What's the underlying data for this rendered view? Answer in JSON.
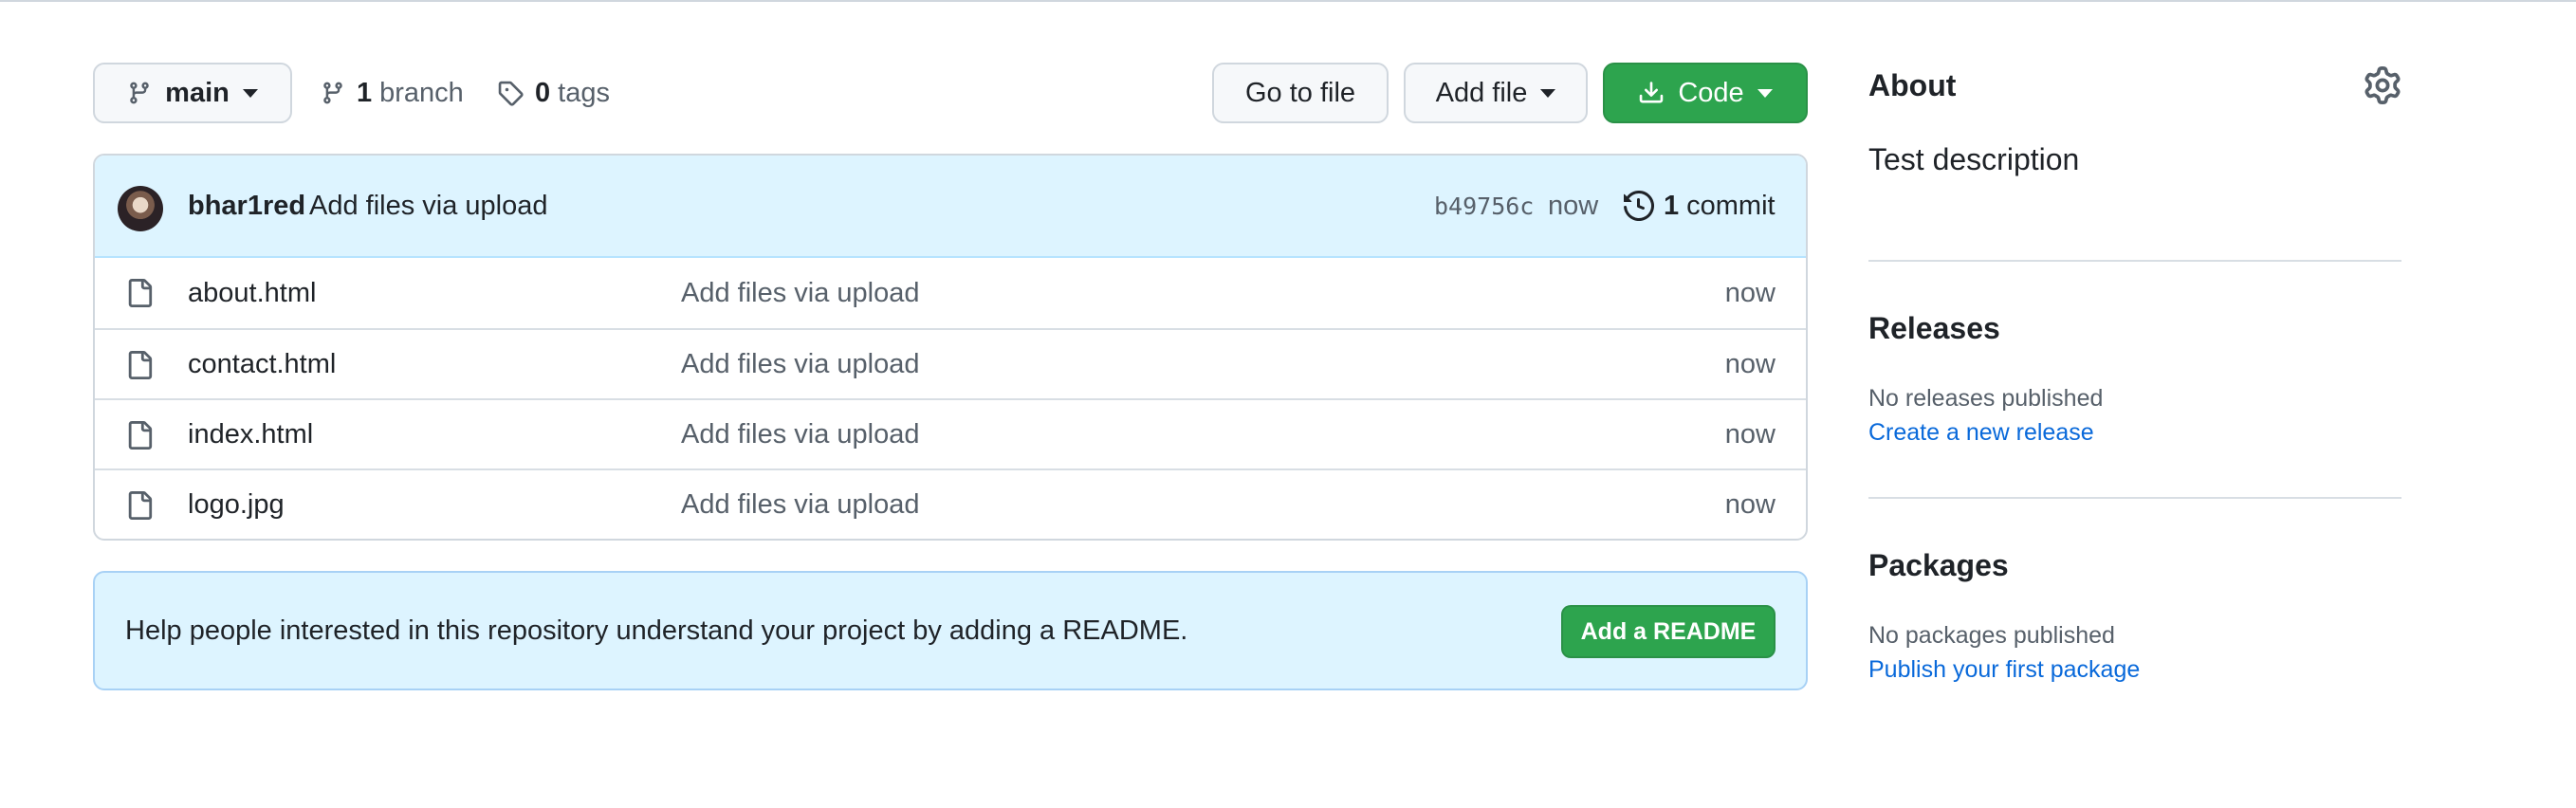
{
  "toolbar": {
    "branch_name": "main",
    "branches_count": "1",
    "branches_label": "branch",
    "tags_count": "0",
    "tags_label": "tags",
    "goto_file_label": "Go to file",
    "add_file_label": "Add file",
    "code_label": "Code"
  },
  "latest_commit": {
    "author": "bhar1red",
    "message": "Add files via upload",
    "sha": "b49756c",
    "time": "now",
    "commit_count": "1",
    "commit_word": "commit"
  },
  "files": [
    {
      "name": "about.html",
      "message": "Add files via upload",
      "time": "now"
    },
    {
      "name": "contact.html",
      "message": "Add files via upload",
      "time": "now"
    },
    {
      "name": "index.html",
      "message": "Add files via upload",
      "time": "now"
    },
    {
      "name": "logo.jpg",
      "message": "Add files via upload",
      "time": "now"
    }
  ],
  "readme_banner": {
    "text": "Help people interested in this repository understand your project by adding a README.",
    "button_label": "Add a README"
  },
  "sidebar": {
    "about_title": "About",
    "description": "Test description",
    "releases_title": "Releases",
    "releases_note": "No releases published",
    "releases_link": "Create a new release",
    "packages_title": "Packages",
    "packages_note": "No packages published",
    "packages_link": "Publish your first package"
  },
  "icons": {
    "branch": "git-branch-icon",
    "tag": "tag-icon",
    "download": "download-icon",
    "history": "history-icon",
    "file": "file-icon",
    "settings": "gear-icon"
  },
  "colors": {
    "primary_green": "#2da44e",
    "link_blue": "#0969da",
    "banner_blue": "#ddf4ff",
    "muted_text": "#57606a"
  }
}
